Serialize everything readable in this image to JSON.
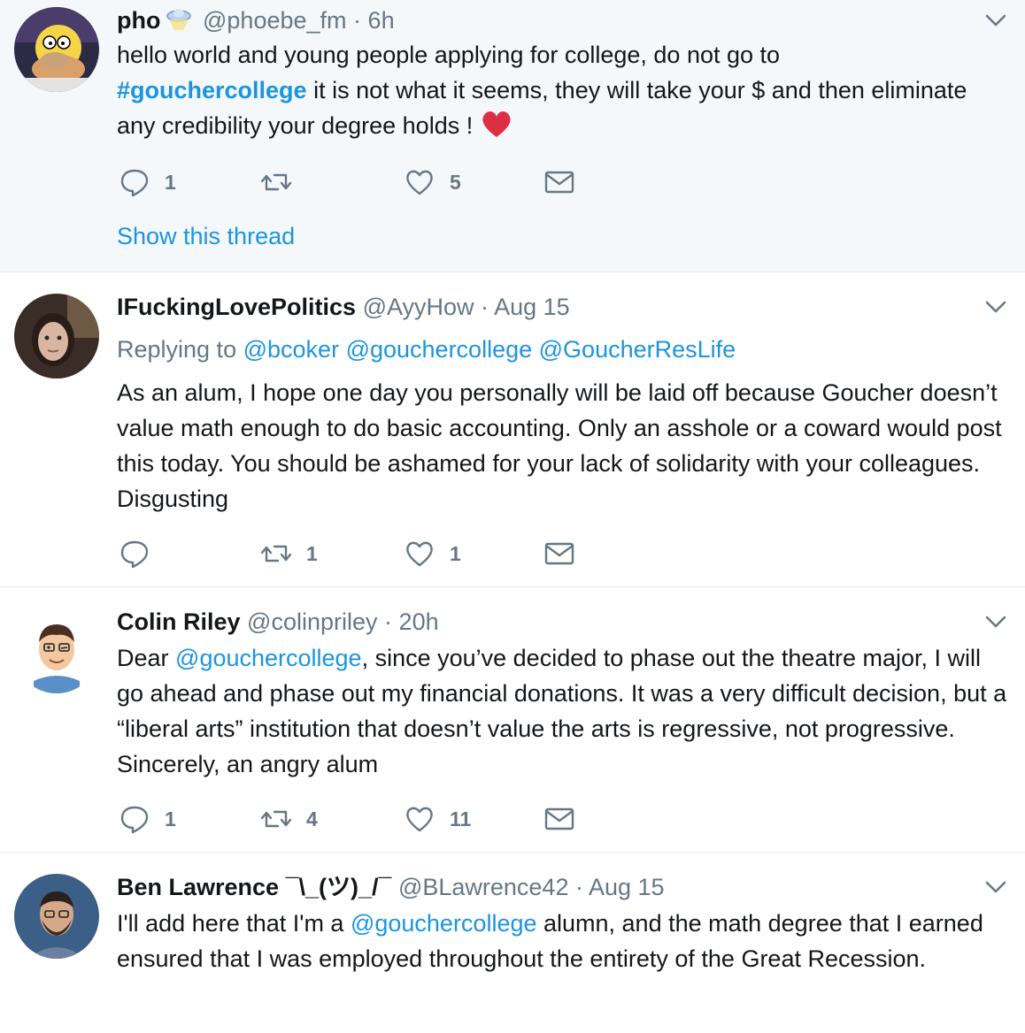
{
  "tweets": [
    {
      "name": "pho",
      "handle": "@phoebe_fm",
      "time": "6h",
      "text_1": "hello world and young people applying for college, do not go to",
      "hashtag": "#gouchercollege",
      "text_2": " it is not what it seems, they will take your $ and then eliminate any credibility your degree holds ! ",
      "replies": "1",
      "retweets": "",
      "likes": "5",
      "show_thread": "Show this thread"
    },
    {
      "name": "IFuckingLovePolitics",
      "handle": "@AyyHow",
      "time": "Aug 15",
      "replying_label": "Replying to",
      "replying_users": [
        "@bcoker",
        "@gouchercollege",
        "@GoucherResLife"
      ],
      "text": "As an alum, I hope one day you personally will be laid off because Goucher doesn’t value math enough to do basic accounting. Only an asshole or a coward would post this today. You should be ashamed for your lack of solidarity with your colleagues. Disgusting",
      "replies": "",
      "retweets": "1",
      "likes": "1"
    },
    {
      "name": "Colin Riley",
      "handle": "@colinpriley",
      "time": "20h",
      "text_1": "Dear ",
      "mention": "@gouchercollege",
      "text_2": ", since you’ve decided to phase out the theatre major, I will go ahead and phase out my financial donations. It was a very difficult decision, but a “liberal arts” institution that doesn’t value the arts is regressive, not progressive. Sincerely, an angry alum",
      "replies": "1",
      "retweets": "4",
      "likes": "11"
    },
    {
      "name": "Ben Lawrence ¯\\_(ツ)_/¯",
      "handle": "@BLawrence42",
      "time": "Aug 15",
      "text_1": "I'll add here that I'm a ",
      "mention": "@gouchercollege",
      "text_2": " alumn, and the math degree that I earned ensured that I was employed throughout the entirety of the Great Recession."
    }
  ],
  "separator": "·",
  "colors": {
    "link": "#1b95e0",
    "muted": "#657786",
    "highlight_bg": "#f5f8fa",
    "heart": "#e0245e"
  }
}
